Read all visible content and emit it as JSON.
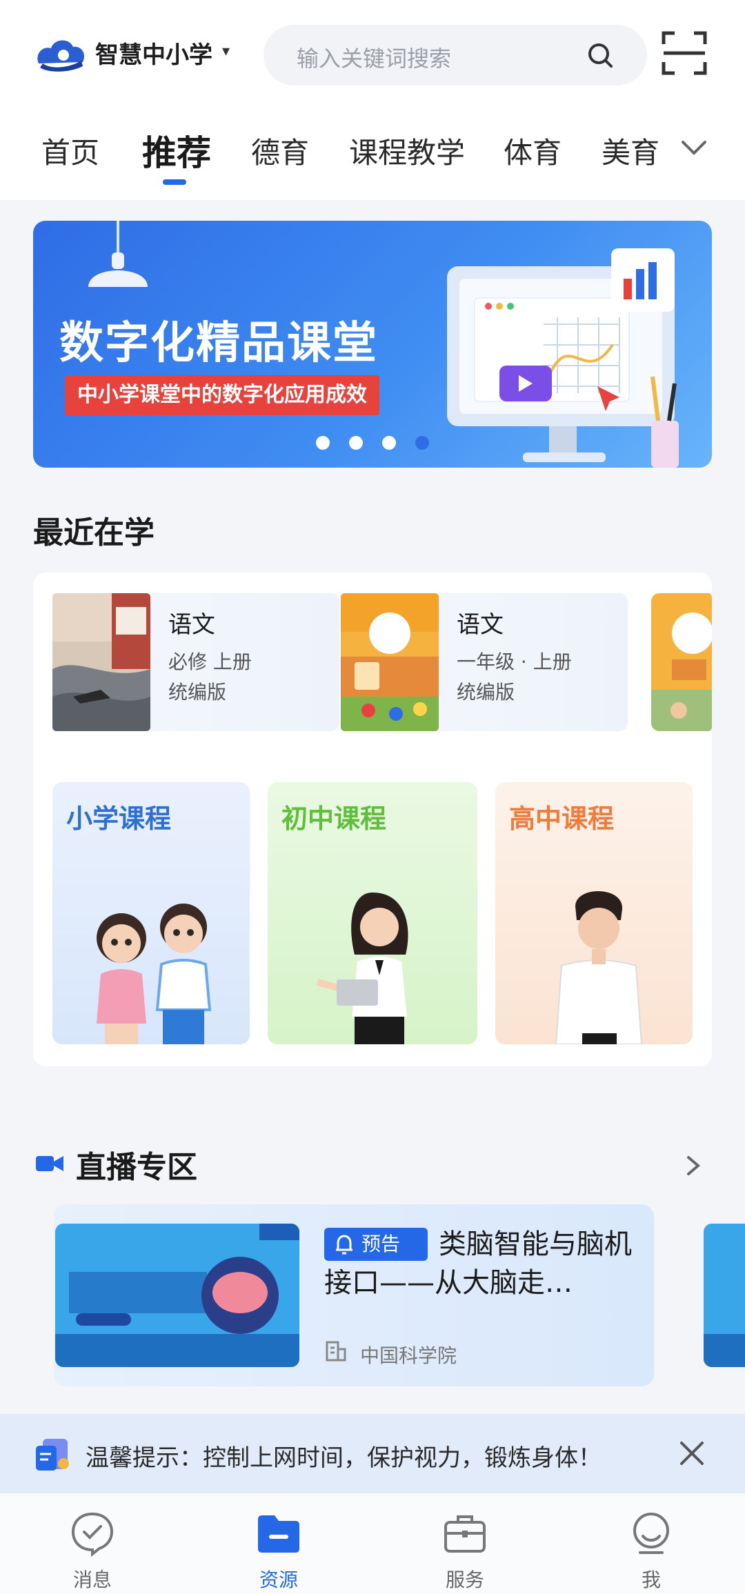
{
  "header": {
    "app_name": "智慧中小学",
    "search_placeholder": "输入关键词搜索"
  },
  "tabs": [
    "首页",
    "推荐",
    "德育",
    "课程教学",
    "体育",
    "美育"
  ],
  "active_tab": "推荐",
  "banner": {
    "title": "数字化精品课堂",
    "subtitle": "中小学课堂中的数字化应用成效",
    "slides": 4,
    "active_slide": 4
  },
  "recent": {
    "title": "最近在学",
    "books": [
      {
        "title": "语文",
        "grade": "必修 上册",
        "edition": "统编版"
      },
      {
        "title": "语文",
        "grade": "一年级 · 上册",
        "edition": "统编版"
      }
    ]
  },
  "courses": [
    {
      "label": "小学课程",
      "color": "#2e6fd6"
    },
    {
      "label": "初中课程",
      "color": "#5fbf3a"
    },
    {
      "label": "高中课程",
      "color": "#ee7d3d"
    }
  ],
  "live": {
    "title": "直播专区",
    "tag": "预告",
    "text": "类脑智能与脑机接口——从大脑走…",
    "org": "中国科学院"
  },
  "tip": {
    "text": "温馨提示：控制上网时间，保护视力，锻炼身体！"
  },
  "nav": [
    "消息",
    "资源",
    "服务",
    "我"
  ],
  "active_nav": "资源",
  "colors": {
    "accent": "#2468e8",
    "tag_red": "#e8423d"
  }
}
